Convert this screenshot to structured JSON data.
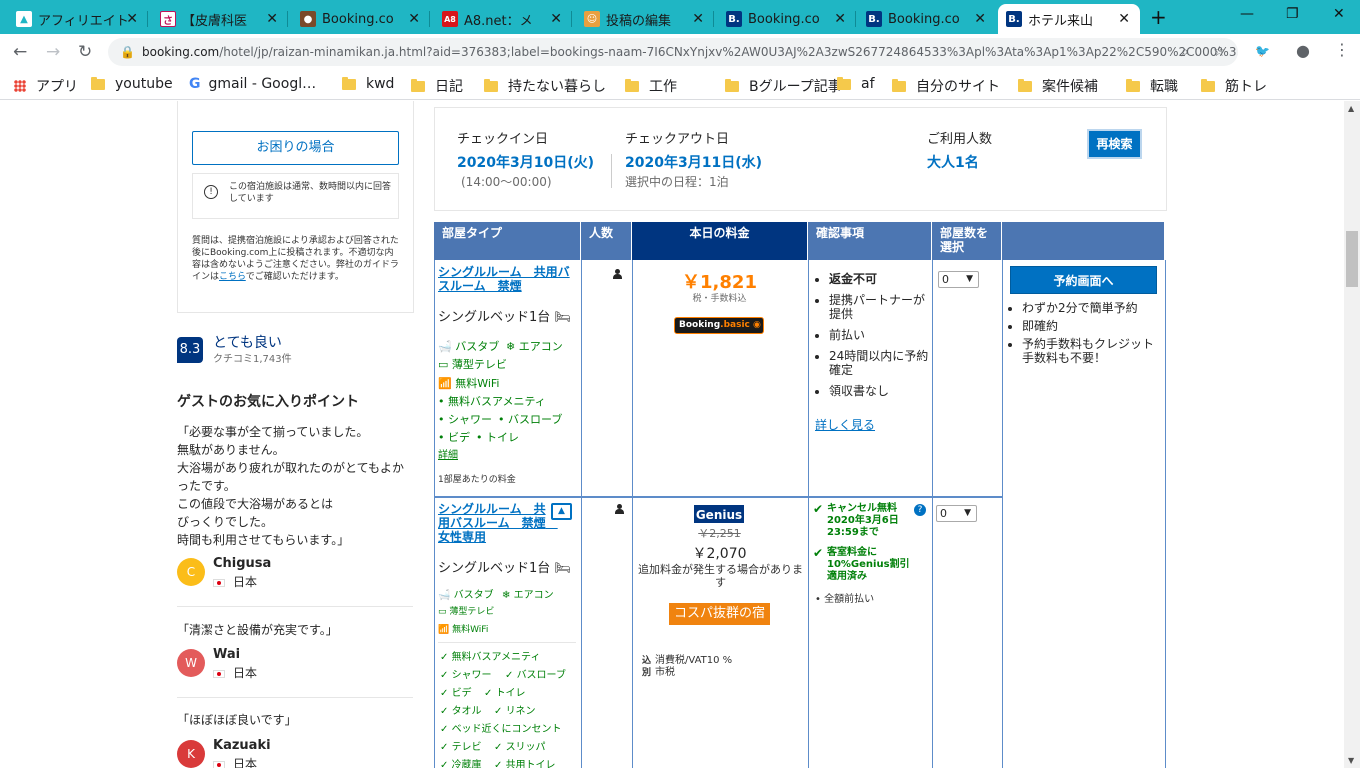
{
  "browser": {
    "tabs": [
      {
        "label": "アフィリエイト",
        "fav": "M",
        "favcolor": "#ffffff"
      },
      {
        "label": "【皮膚科医",
        "fav": "さ",
        "favcolor": "#c0145a"
      },
      {
        "label": "Booking.co",
        "fav": "⚈",
        "favcolor": "#7a4a2a"
      },
      {
        "label": "A8.net：メ",
        "fav": "A8",
        "favcolor": "#d8161b"
      },
      {
        "label": "投稿の編集",
        "fav": "☺",
        "favcolor": "#e8a040"
      },
      {
        "label": "Booking.co",
        "fav": "B.",
        "favcolor": "#003580"
      },
      {
        "label": "Booking.co",
        "fav": "B.",
        "favcolor": "#003580"
      },
      {
        "label": "ホテル来山",
        "fav": "B.",
        "favcolor": "#003580"
      }
    ],
    "url_host": "booking.com",
    "url_path": "/hotel/jp/raizan-minamikan.ja.html?aid=376383;label=bookings-naam-7I6CNxYnjxv%2AW0U3AJ%2A3zwS267724864533%3Apl%3Ata%3Ap1%3Ap22%2C590%2C000%3…",
    "bookmarks": [
      "アプリ",
      "youtube",
      "gmail - Googl…",
      "kwd",
      "日記",
      "持たない暮らし",
      "工作",
      "Bグループ記事",
      "af",
      "自分のサイト",
      "案件候補",
      "転職",
      "筋トレ"
    ]
  },
  "sidebar": {
    "help_button": "お困りの場合",
    "response_note": "この宿泊施設は通常、数時間以内に回答しています",
    "notice_text": "質問は、提携宿泊施設により承認および回答された後にBooking.com上に投稿されます。不適切な内容は含めないようご注意ください。弊社のガイドラインは",
    "notice_link": "こちら",
    "notice_tail": "でご確認いただけます。",
    "score": "8.3",
    "score_label": "とても良い",
    "review_count": "クチコミ1,743件",
    "favorites_title": "ゲストのお気に入りポイント",
    "reviews": [
      {
        "quote": "「必要な事が全て揃っていました。\n無駄がありません。\n大浴場があり疲れが取れたのがとてもよかったです。\nこの値段で大浴場があるとは\nびっくりでした。\n時間も利用させてもらいます。」",
        "initial": "C",
        "name": "Chigusa",
        "country": "日本",
        "color": "#fbbd19"
      },
      {
        "quote": "「清潔さと設備が充実です。」",
        "initial": "W",
        "name": "Wai",
        "country": "日本",
        "color": "#e35b5b"
      },
      {
        "quote": "「ほぼほぼ良いです」",
        "initial": "K",
        "name": "Kazuaki",
        "country": "日本",
        "color": "#d93a3a"
      }
    ]
  },
  "search": {
    "checkin_label": "チェックイン日",
    "checkin_date": "2020年3月10日(火)",
    "checkin_time": "(14:00〜00:00)",
    "checkout_label": "チェックアウト日",
    "checkout_date": "2020年3月11日(水)",
    "nights": "選択中の日程：1泊",
    "guests_label": "ご利用人数",
    "guests_value": "大人1名",
    "research_button": "再検索"
  },
  "table": {
    "headers": {
      "room_type": "部屋タイプ",
      "people": "人数",
      "today_price": "本日の料金",
      "conditions": "確認事項",
      "rooms_select": "部屋数を\n選択"
    },
    "row1": {
      "title": "シングルルーム　共用バスルーム　禁煙",
      "bed": "シングルベッド1台",
      "facilities": [
        "バスタブ",
        "エアコン",
        "薄型テレビ",
        "無料WiFi",
        "無料バスアメニティ",
        "シャワー",
        "バスローブ",
        "ビデ",
        "トイレ"
      ],
      "details_link": "詳細",
      "per_room": "1部屋あたりの料金",
      "price": "￥1,821",
      "tax_note": "税・手数料込",
      "badge_text": "Booking",
      "badge_accent": ".basic",
      "conditions": [
        "返金不可",
        "提携パートナーが提供",
        "前払い",
        "24時間以内に予約確定",
        "領収書なし"
      ],
      "more_link": "詳しく見る",
      "qty": "0",
      "reserve_button": "予約画面へ",
      "benefits": [
        "わずか2分で簡単予約",
        "即確約",
        "予約手数料もクレジット手数料も不要！"
      ]
    },
    "row2": {
      "title": "シングルルーム　共用バスルーム　禁煙　女性専用",
      "bed": "シングルベッド1台",
      "facilities": [
        "バスタブ",
        "エアコン",
        "薄型テレビ",
        "無料WiFi"
      ],
      "checks": [
        "無料バスアメニティ",
        "シャワー",
        "バスローブ",
        "ビデ",
        "トイレ",
        "タオル",
        "リネン",
        "ベッド近くにコンセント",
        "テレビ",
        "スリッパ",
        "冷蔵庫",
        "共用トイレ"
      ],
      "genius": "Genius",
      "old_price": "￥2,251",
      "price": "￥2,070",
      "additional": "追加料金が発生する場合があります",
      "cospa": "コスパ抜群の宿",
      "vat_in": "込",
      "vat_label": "消費税/VAT10 %",
      "city_in": "別",
      "city_label": "市税",
      "cancel": "キャンセル無料\n2020年3月6日\n23:59まで",
      "genius_discount": "客室料金に\n10%Genius割引\n適用済み",
      "prepay": "全額前払い",
      "qty": "0"
    }
  }
}
